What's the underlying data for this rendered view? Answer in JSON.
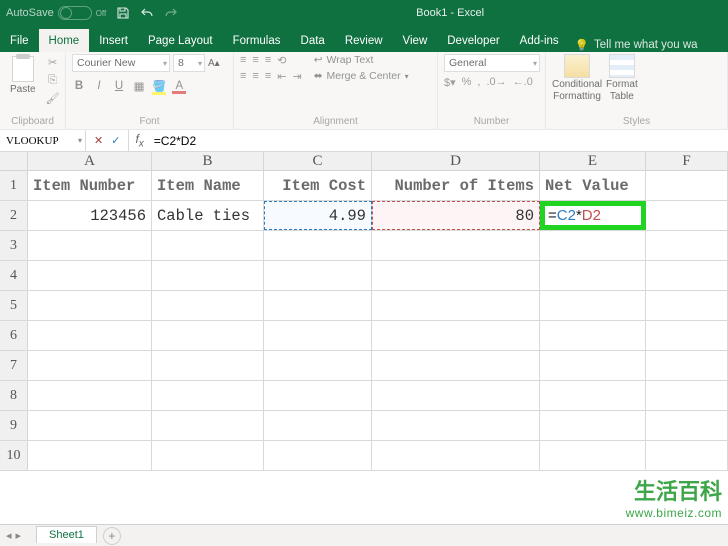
{
  "titlebar": {
    "autosave": "AutoSave",
    "autosave_state": "Off",
    "doc_title": "Book1 - Excel"
  },
  "tabs": {
    "file": "File",
    "home": "Home",
    "insert": "Insert",
    "page_layout": "Page Layout",
    "formulas": "Formulas",
    "data": "Data",
    "review": "Review",
    "view": "View",
    "developer": "Developer",
    "addins": "Add-ins",
    "tellme": "Tell me what you wa"
  },
  "ribbon": {
    "clipboard": {
      "label": "Clipboard",
      "paste": "Paste"
    },
    "font": {
      "label": "Font",
      "name": "Courier New",
      "size": "8"
    },
    "alignment": {
      "label": "Alignment",
      "wrap": "Wrap Text",
      "merge": "Merge & Center"
    },
    "number": {
      "label": "Number",
      "format": "General"
    },
    "styles": {
      "label": "Styles",
      "cf": "Conditional",
      "cf2": "Formatting",
      "ft": "Format",
      "ft2": "Table"
    }
  },
  "fx": {
    "namebox": "VLOOKUP",
    "formula": "=C2*D2"
  },
  "columns": [
    "A",
    "B",
    "C",
    "D",
    "E",
    "F"
  ],
  "headers": {
    "A": "Item Number",
    "B": "Item Name",
    "C": "Item Cost",
    "D": "Number of Items",
    "E": "Net Value"
  },
  "r2": {
    "A": "123456",
    "B": "Cable ties",
    "C": "4.99",
    "D": "80"
  },
  "edit": {
    "eq": "=",
    "ref1": "C2",
    "op": "*",
    "ref2": "D2"
  },
  "sheettab": "Sheet1",
  "watermark": {
    "t1": "生活百科",
    "t2": "www.bimeiz.com"
  }
}
